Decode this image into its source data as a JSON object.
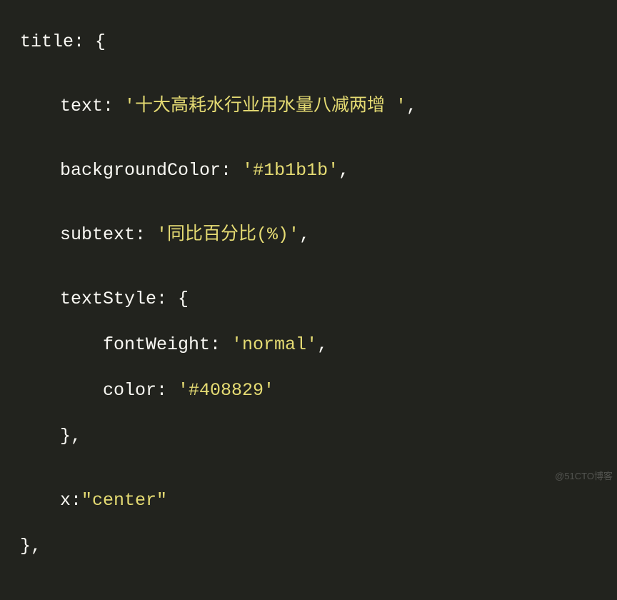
{
  "code": {
    "titleKey": "title:",
    "openBrace": "{",
    "closeBrace": "}",
    "closeBraceComma": "},",
    "textKey": "text:",
    "textVal": "'十大高耗水行业用水量八减两增 '",
    "bgKey": "backgroundColor:",
    "bgVal": "'#1b1b1b'",
    "subtextKey": "subtext:",
    "subtextVal": "'同比百分比(%)'",
    "textStyleKey": "textStyle:",
    "fontWeightKey": "fontWeight:",
    "fontWeightVal": "'normal'",
    "colorKey": "color:",
    "colorVal": "'#408829'",
    "xKey": "x:",
    "xVal": "\"center\"",
    "comma": ","
  },
  "watermark": "@51CTO博客"
}
